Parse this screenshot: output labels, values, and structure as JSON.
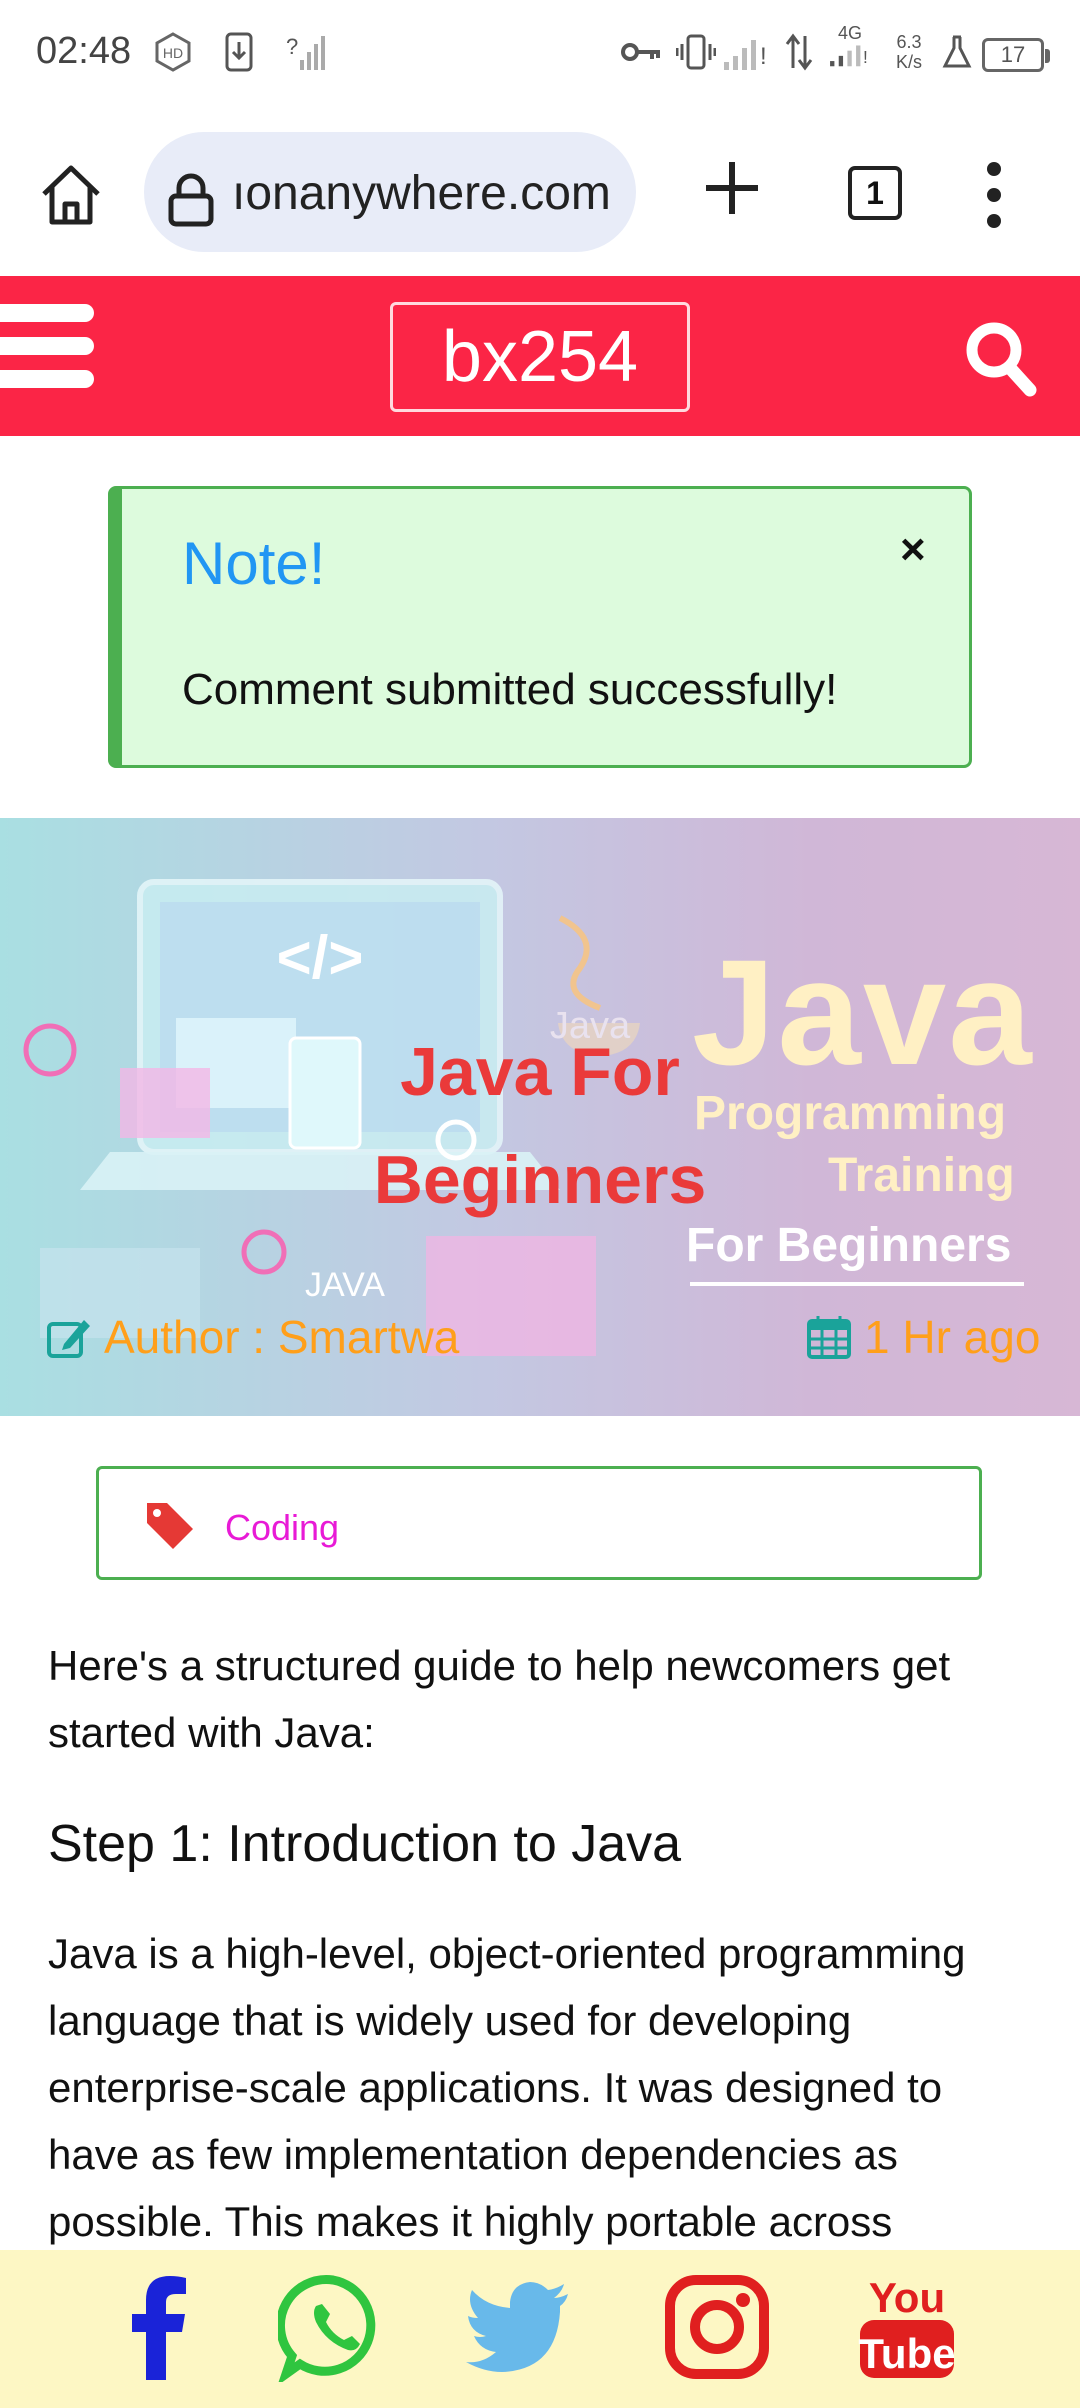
{
  "status_bar": {
    "time": "02:48",
    "network_type": "4G",
    "speed_value": "6.3",
    "speed_unit": "K/s",
    "battery": "17",
    "icons": [
      "hd-icon",
      "download-icon",
      "no-signal-icon",
      "key-icon",
      "vibrate-icon",
      "signal-icon",
      "data-arrows-icon",
      "lab-icon",
      "battery-icon"
    ]
  },
  "browser": {
    "url": "ıonanywhere.com",
    "tab_count": "1",
    "icons": [
      "home-icon",
      "lock-icon",
      "plus-icon",
      "tabs-icon",
      "more-vertical-icon"
    ]
  },
  "site_header": {
    "logo_text": "bx254",
    "background_color": "#fb2546",
    "icons": [
      "hamburger-menu-icon",
      "search-icon"
    ]
  },
  "note": {
    "title": "Note!",
    "close_label": "×",
    "message": "Comment submitted successfully!",
    "background_color": "#ddfbdd",
    "border_color": "#4caf50",
    "title_color": "#2196f3"
  },
  "hero": {
    "title_line1": "Java For",
    "title_line2": "Beginners",
    "image_text_java": "Java",
    "image_text_programming": "Programming",
    "image_text_training": "Training",
    "image_text_for_beginners": "For Beginners",
    "image_text_code_tag": "</>",
    "image_text_small_java": "Java",
    "image_text_screen_java": "JAVA",
    "author": "Author : Smartwa",
    "time_ago": "1 Hr ago",
    "meta_color": "#ff9f1a",
    "title_color": "#ea3a3a"
  },
  "tag": {
    "label": "Coding",
    "label_color": "#e81ad6",
    "icon": "tag-icon"
  },
  "article": {
    "intro": "Here's a structured guide to help newcomers get started with Java:",
    "step1_heading": "Step 1: Introduction to Java",
    "step1_body": "Java is a high-level, object-oriented programming language that is widely used for developing enterprise-scale applications. It was designed to have as few implementation dependencies as possible. This makes it highly portable across"
  },
  "social": {
    "background_color": "#fdf7c4",
    "icons": [
      "facebook-icon",
      "whatsapp-icon",
      "twitter-icon",
      "instagram-icon",
      "youtube-icon"
    ],
    "youtube_top": "You",
    "youtube_bottom": "Tube"
  }
}
